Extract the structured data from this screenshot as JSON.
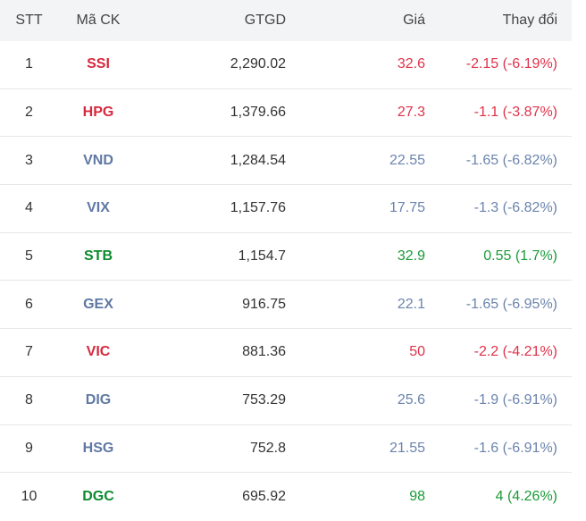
{
  "header": {
    "stt": "STT",
    "ma_ck": "Mã CK",
    "gtgd": "GTGD",
    "gia": "Giá",
    "thay_doi": "Thay đổi"
  },
  "colors": {
    "down": "#e0324a",
    "reference": "#6b84ad",
    "up": "#1a9a38",
    "header_bg": "#f3f4f6"
  },
  "rows": [
    {
      "stt": "1",
      "ma_ck": "SSI",
      "gtgd": "2,290.02",
      "gia": "32.6",
      "thay_doi": "-2.15 (-6.19%)",
      "status": "down"
    },
    {
      "stt": "2",
      "ma_ck": "HPG",
      "gtgd": "1,379.66",
      "gia": "27.3",
      "thay_doi": "-1.1 (-3.87%)",
      "status": "down"
    },
    {
      "stt": "3",
      "ma_ck": "VND",
      "gtgd": "1,284.54",
      "gia": "22.55",
      "thay_doi": "-1.65 (-6.82%)",
      "status": "flat"
    },
    {
      "stt": "4",
      "ma_ck": "VIX",
      "gtgd": "1,157.76",
      "gia": "17.75",
      "thay_doi": "-1.3 (-6.82%)",
      "status": "flat"
    },
    {
      "stt": "5",
      "ma_ck": "STB",
      "gtgd": "1,154.7",
      "gia": "32.9",
      "thay_doi": "0.55 (1.7%)",
      "status": "up"
    },
    {
      "stt": "6",
      "ma_ck": "GEX",
      "gtgd": "916.75",
      "gia": "22.1",
      "thay_doi": "-1.65 (-6.95%)",
      "status": "flat"
    },
    {
      "stt": "7",
      "ma_ck": "VIC",
      "gtgd": "881.36",
      "gia": "50",
      "thay_doi": "-2.2 (-4.21%)",
      "status": "down"
    },
    {
      "stt": "8",
      "ma_ck": "DIG",
      "gtgd": "753.29",
      "gia": "25.6",
      "thay_doi": "-1.9 (-6.91%)",
      "status": "flat"
    },
    {
      "stt": "9",
      "ma_ck": "HSG",
      "gtgd": "752.8",
      "gia": "21.55",
      "thay_doi": "-1.6 (-6.91%)",
      "status": "flat"
    },
    {
      "stt": "10",
      "ma_ck": "DGC",
      "gtgd": "695.92",
      "gia": "98",
      "thay_doi": "4 (4.26%)",
      "status": "up"
    }
  ]
}
